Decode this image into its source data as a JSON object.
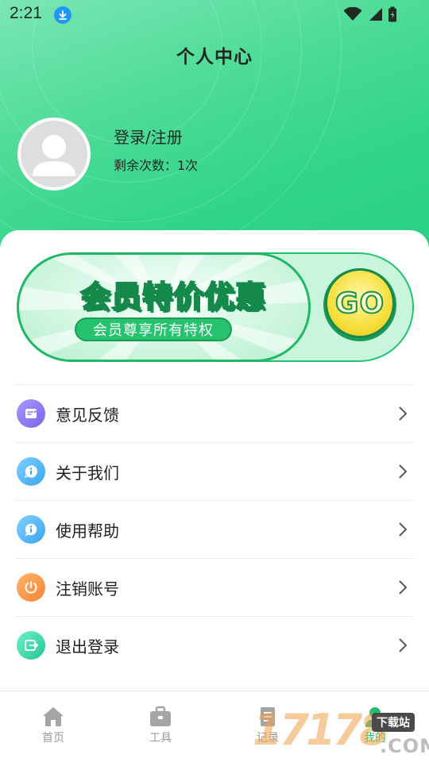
{
  "status_bar": {
    "time": "2:21"
  },
  "header": {
    "title": "个人中心"
  },
  "profile": {
    "login_label": "登录/注册",
    "remaining": "剩余次数：1次"
  },
  "banner": {
    "title": "会员特价优惠",
    "subtitle": "会员尊享所有特权",
    "go_label": "GO"
  },
  "menu": {
    "items": [
      {
        "label": "意见反馈",
        "icon": "feedback-icon",
        "color": "#8f7cf0"
      },
      {
        "label": "关于我们",
        "icon": "info-icon",
        "color": "#4fb3f2"
      },
      {
        "label": "使用帮助",
        "icon": "help-icon",
        "color": "#4fb3f2"
      },
      {
        "label": "注销账号",
        "icon": "deregister-icon",
        "color": "#f7984a"
      },
      {
        "label": "退出登录",
        "icon": "logout-icon",
        "color": "#39d6a4"
      }
    ]
  },
  "tabbar": {
    "tabs": [
      {
        "label": "首页",
        "icon": "home-icon"
      },
      {
        "label": "工具",
        "icon": "toolbox-icon"
      },
      {
        "label": "记录",
        "icon": "record-icon"
      },
      {
        "label": "我的",
        "icon": "profile-icon",
        "active": true
      }
    ]
  },
  "watermark": {
    "digits": "17178",
    "tag": "下载站",
    "domain": ".COM"
  },
  "colors": {
    "primary": "#2ad083",
    "active_tab": "#22c06e",
    "text": "#1f1f1f"
  }
}
